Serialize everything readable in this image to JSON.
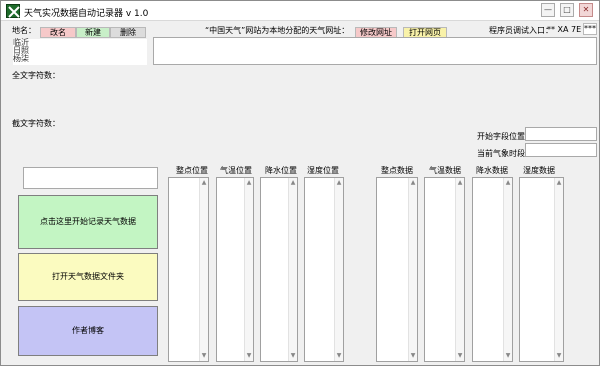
{
  "window": {
    "title": "天气实况数据自动记录器 v 1.0",
    "controls": {
      "minimize": "—",
      "maximize": "□",
      "close": "✕"
    }
  },
  "top": {
    "place_label": "地名：",
    "rename_label": "改名",
    "new_label": "新建",
    "delete_label": "删除",
    "url_prompt": "“中国天气”网站为本地分配的天气网址：",
    "edit_url_label": "修改网址",
    "open_page_label": "打开网页",
    "debug_label": "程序员调试入口：",
    "debug_value": "** XA 7E",
    "debug_button": "***"
  },
  "places": [
    "临沂",
    "日照",
    "杨柒"
  ],
  "fields": {
    "full_char_count": "全文字符数：",
    "cut_char_count": "截文字符数：",
    "start_pos": "开始字段位置：",
    "current_time": "当前气象时段："
  },
  "actions": {
    "start_record": "点击这里开始记录天气数据",
    "open_folder": "打开天气数据文件夹",
    "author_blog": "作者博客"
  },
  "columns": {
    "left": [
      "整点位置",
      "气温位置",
      "降水位置",
      "湿度位置"
    ],
    "right": [
      "整点数据",
      "气温数据",
      "降水数据",
      "湿度数据"
    ]
  },
  "colors": {
    "start_btn": "#c3f5c3",
    "folder_btn": "#fbfbc0",
    "blog_btn": "#c4c4f5",
    "rename_btn": "#f6c9c9",
    "new_btn": "#c8efc8",
    "open_btn": "#f9f2a9"
  },
  "icons": [
    "app-logo-icon",
    "scroll-up-icon",
    "scroll-down-icon"
  ]
}
